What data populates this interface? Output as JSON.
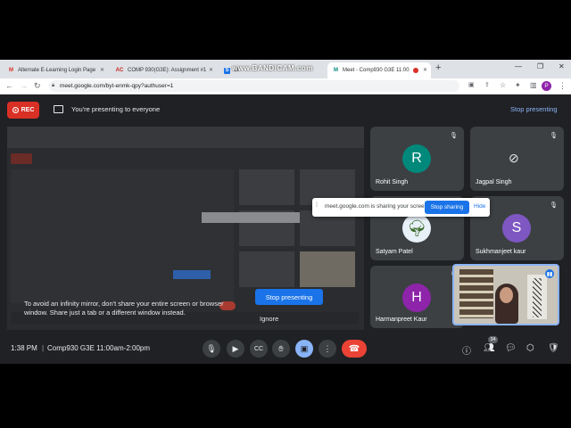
{
  "browser": {
    "tabs": [
      {
        "icon": "M",
        "label": "Alternate E-Learning Login Page",
        "color": "#d93025"
      },
      {
        "icon": "AC",
        "label": "COMP 930(G3E): Assignment #1",
        "color": "#c5221f"
      },
      {
        "icon": "S",
        "label": "St",
        "color": "#1a73e8"
      },
      {
        "icon": "M",
        "label": "Meet - Comp930 G3E 11:00",
        "color": "#00897b"
      }
    ],
    "new_tab": "+",
    "url": "meet.google.com/byt-enmk-qpy?authuser=1",
    "profile_initial": "P",
    "watermark": "www.BANDICAM.com"
  },
  "presenting_bar": {
    "rec_label": "REC",
    "message": "You're presenting to everyone",
    "stop_label": "Stop presenting"
  },
  "shared_screen": {
    "mirror_message": "To avoid an infinity mirror, don't share your entire screen or browser window. Share just a tab or a different window instead.",
    "stop_button": "Stop presenting",
    "ignore_label": "Ignore"
  },
  "share_notification": {
    "message": "meet.google.com is sharing your screen.",
    "stop_button": "Stop sharing",
    "hide_button": "Hide"
  },
  "participants": [
    {
      "name": "Rohit Singh",
      "initial": "R",
      "color": "#00897b",
      "type": "avatar"
    },
    {
      "name": "Jagpal Singh",
      "initial": "",
      "color": "",
      "type": "camera-off"
    },
    {
      "name": "Satyam Patel",
      "initial": "",
      "color": "",
      "type": "photo"
    },
    {
      "name": "Sukhmanjeet kaur",
      "initial": "S",
      "color": "#7e57c2",
      "type": "avatar"
    },
    {
      "name": "Harmanpreet Kaur",
      "initial": "H",
      "color": "#8e24aa",
      "type": "avatar"
    }
  ],
  "bottom_bar": {
    "time": "1:38 PM",
    "meeting": "Comp930 G3E 11:00am-2:00pm",
    "people_count": "34"
  },
  "colors": {
    "meet_bg": "#202124",
    "tile_bg": "#3c4043",
    "accent": "#1a73e8",
    "end_call": "#ea4335",
    "rec": "#d93025"
  }
}
